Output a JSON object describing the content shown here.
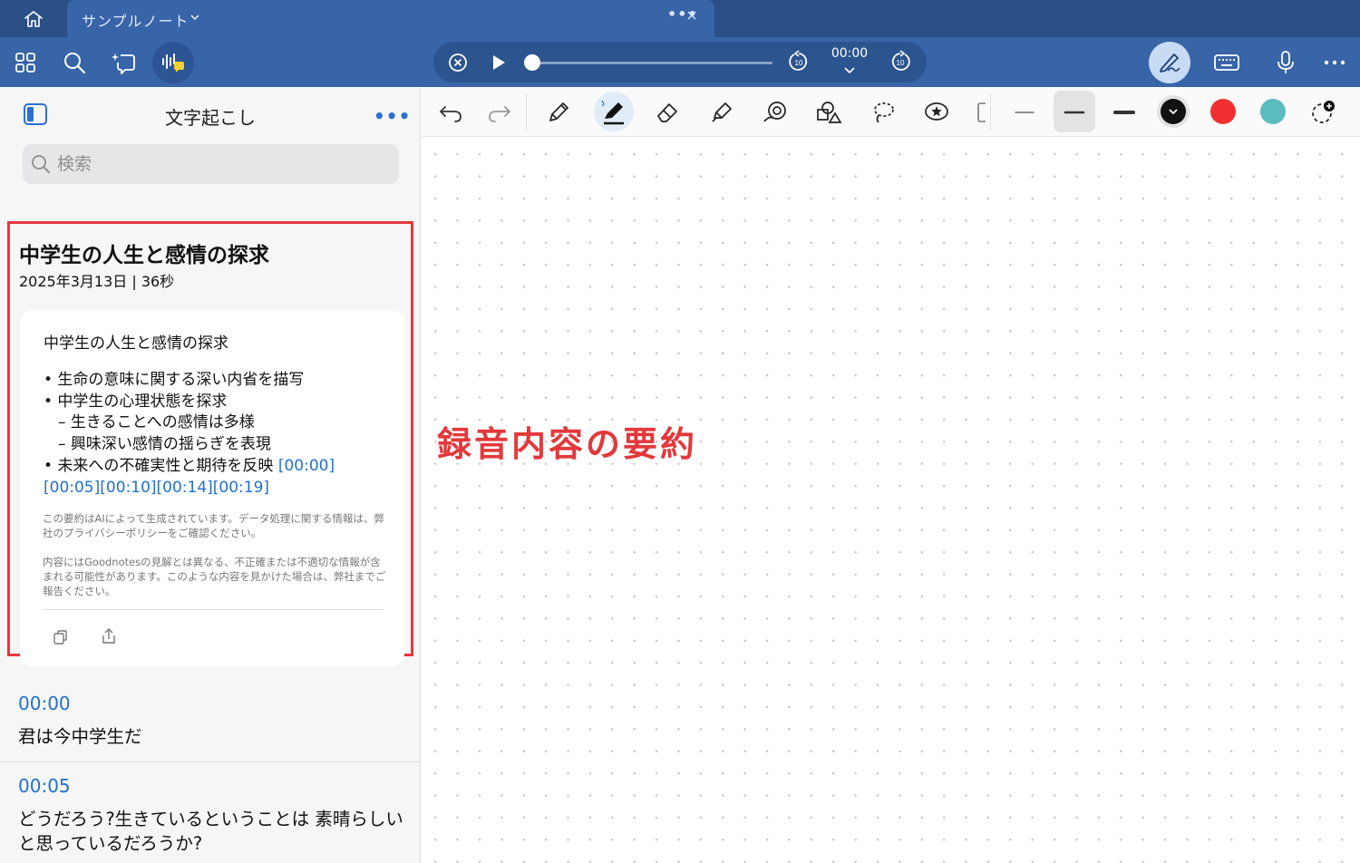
{
  "tabbar": {
    "home_icon": "home-icon",
    "tab_title": "サンプルノート",
    "tab_menu_icon": "chevron-down-icon",
    "tab_dots": "•••",
    "tab_close_icon": "close-icon"
  },
  "toolbar": {
    "left_icons": [
      "grid-icon",
      "search-icon",
      "ai-sparkle-icon",
      "transcription-icon"
    ],
    "player": {
      "stop_icon": "stop-circle-icon",
      "play_icon": "play-icon",
      "progress": 0,
      "time": "00:00",
      "back_icon": "rewind-10-icon",
      "forward_icon": "forward-10-icon"
    },
    "right_icons": [
      "pen-hand-icon",
      "keyboard-icon",
      "microphone-icon",
      "more-icon"
    ]
  },
  "sidebar": {
    "title": "文字起こし",
    "more": "•••",
    "search_placeholder": "検索",
    "summary": {
      "title": "中学生の人生と感情の探求",
      "meta": "2025年3月13日 | 36秒",
      "card": {
        "title": "中学生の人生と感情の探求",
        "bullets": [
          "• 生命の意味に関する深い内省を描写",
          "• 中学生の心理状態を探求",
          "– 生きることへの感情は多様",
          "– 興味深い感情の揺らぎを表現",
          "• 未来への不確実性と期待を反映"
        ],
        "timestamps_inline": "[00:00]",
        "timestamps_line": "[00:05][00:10][00:14][00:19]",
        "disclaimer1": "この要約はAIによって生成されています。データ処理に関する情報は、弊社のプライバシーポリシーをご確認ください。",
        "disclaimer2": "内容にはGoodnotesの見解とは異なる、不正確または不適切な情報が含まれる可能性があります。このような内容を見かけた場合は、弊社までご報告ください。"
      }
    },
    "transcript": [
      {
        "time": "00:00",
        "text": "君は今中学生だ"
      },
      {
        "time": "00:05",
        "text": "どうだろう?生きているということは 素晴らしいと思っているだろうか?"
      }
    ]
  },
  "canvas_tools": {
    "tools": [
      "undo-icon",
      "redo-icon",
      "pencil-icon",
      "fountain-pen-icon",
      "eraser-icon",
      "highlighter-icon",
      "shape-icon",
      "elements-icon",
      "lasso-icon",
      "sticker-icon"
    ],
    "colors": [
      "#111111",
      "#f03030",
      "#5bbcbd"
    ]
  },
  "annotation": "録音内容の要約"
}
